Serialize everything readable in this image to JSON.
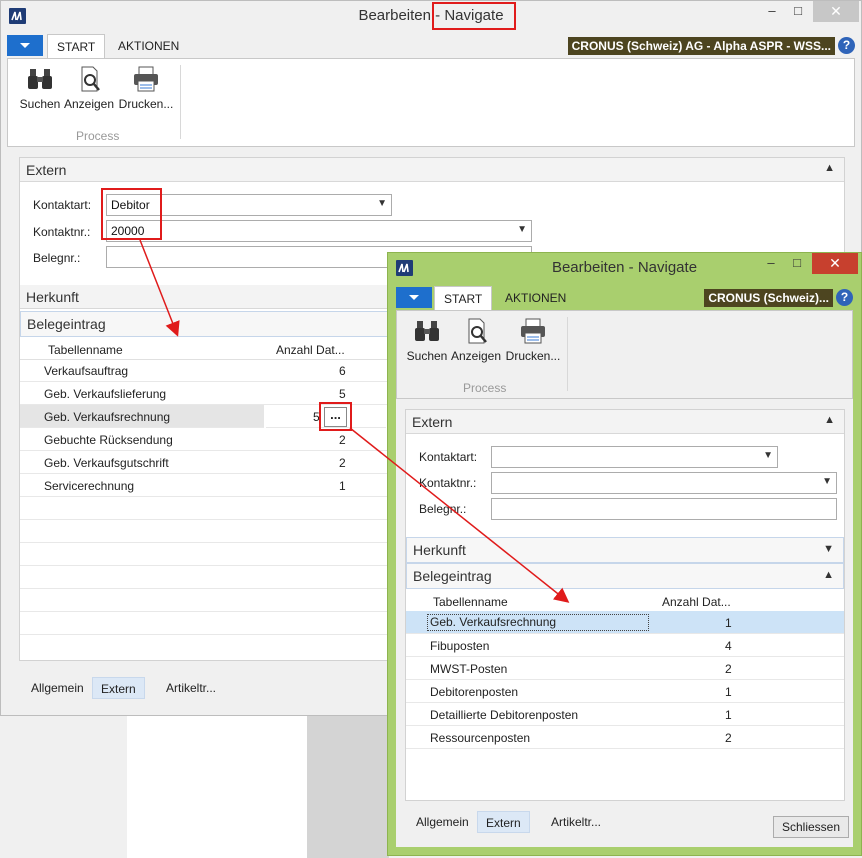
{
  "main_window": {
    "title_left": "Bearbeiten",
    "title_right": "- Navigate",
    "tabs": [
      {
        "label": "START"
      },
      {
        "label": "AKTIONEN"
      }
    ],
    "company": "CRONUS (Schweiz) AG - Alpha ASPR - WSS...",
    "help": "?",
    "ribbon": {
      "buttons": [
        {
          "label": "Suchen",
          "icon": "binoculars-icon"
        },
        {
          "label": "Anzeigen",
          "icon": "view-document-icon"
        },
        {
          "label": "Drucken...",
          "icon": "printer-icon"
        }
      ],
      "group_label": "Process"
    },
    "extern": {
      "header": "Extern",
      "kontaktart_label": "Kontaktart:",
      "kontaktart_value": "Debitor",
      "kontaktnr_label": "Kontaktnr.:",
      "kontaktnr_value": "20000",
      "belegnr_label": "Belegnr.:",
      "belegnr_value": ""
    },
    "herkunft": {
      "header": "Herkunft"
    },
    "belegeintrag": {
      "header": "Belegeintrag",
      "col_name": "Tabellenname",
      "col_count": "Anzahl Dat...",
      "rows": [
        {
          "name": "Verkaufsauftrag",
          "count": "6"
        },
        {
          "name": "Geb. Verkaufslieferung",
          "count": "5"
        },
        {
          "name": "Geb. Verkaufsrechnung",
          "count": "5"
        },
        {
          "name": "Gebuchte Rücksendung",
          "count": "2"
        },
        {
          "name": "Geb. Verkaufsgutschrift",
          "count": "2"
        },
        {
          "name": "Servicerechnung",
          "count": "1"
        }
      ],
      "ellipsis": "..."
    },
    "footer_tabs": [
      {
        "label": "Allgemein"
      },
      {
        "label": "Extern"
      },
      {
        "label": "Artikeltr..."
      }
    ]
  },
  "sub_window": {
    "title": "Bearbeiten - Navigate",
    "tabs": [
      {
        "label": "START"
      },
      {
        "label": "AKTIONEN"
      }
    ],
    "company": "CRONUS (Schweiz)...",
    "help": "?",
    "ribbon": {
      "buttons": [
        {
          "label": "Suchen",
          "icon": "binoculars-icon"
        },
        {
          "label": "Anzeigen",
          "icon": "view-document-icon"
        },
        {
          "label": "Drucken...",
          "icon": "printer-icon"
        }
      ],
      "group_label": "Process"
    },
    "extern": {
      "header": "Extern",
      "kontaktart_label": "Kontaktart:",
      "kontaktart_value": "",
      "kontaktnr_label": "Kontaktnr.:",
      "kontaktnr_value": "",
      "belegnr_label": "Belegnr.:",
      "belegnr_value": ""
    },
    "herkunft": {
      "header": "Herkunft"
    },
    "belegeintrag": {
      "header": "Belegeintrag",
      "col_name": "Tabellenname",
      "col_count": "Anzahl Dat...",
      "rows": [
        {
          "name": "Geb. Verkaufsrechnung",
          "count": "1"
        },
        {
          "name": "Fibuposten",
          "count": "4"
        },
        {
          "name": "MWST-Posten",
          "count": "2"
        },
        {
          "name": "Debitorenposten",
          "count": "1"
        },
        {
          "name": "Detaillierte Debitorenposten",
          "count": "1"
        },
        {
          "name": "Ressourcenposten",
          "count": "2"
        }
      ]
    },
    "footer_tabs": [
      {
        "label": "Allgemein"
      },
      {
        "label": "Extern"
      },
      {
        "label": "Artikeltr..."
      }
    ],
    "close_button": "Schliessen"
  },
  "colors": {
    "accent_blue": "#1e6fcd",
    "sub_window_frame": "#a9cf6e",
    "annotation_red": "#e01b1b",
    "company_bg": "#4d4520"
  }
}
